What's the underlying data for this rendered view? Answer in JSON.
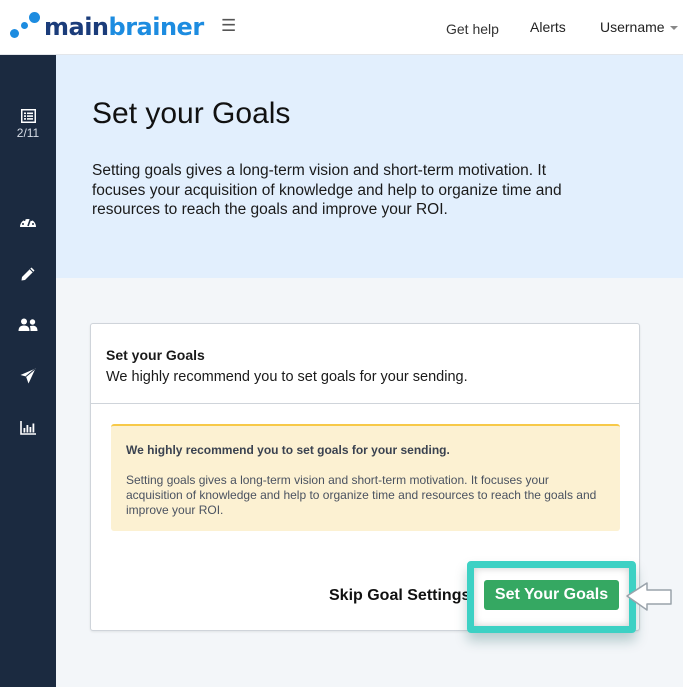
{
  "header": {
    "logo": {
      "part1": "main",
      "part2": "brainer"
    },
    "menu_icon": "hamburger-icon",
    "nav": {
      "help": "Get help",
      "alerts": "Alerts",
      "user": "Username"
    }
  },
  "sidebar": {
    "items": [
      {
        "icon": "list-icon",
        "label": "2/11"
      },
      {
        "icon": "dashboard-gauge-icon"
      },
      {
        "icon": "pencil-icon"
      },
      {
        "icon": "users-icon"
      },
      {
        "icon": "paper-plane-icon"
      },
      {
        "icon": "bar-chart-icon"
      }
    ]
  },
  "hero": {
    "title": "Set your Goals",
    "description": "Setting goals gives a long-term vision and short-term motivation. It focuses your acquisition of knowledge and help to organize time and resources to reach the goals and improve your ROI."
  },
  "card": {
    "title": "Set your Goals",
    "subtitle": "We highly recommend you to set goals for your sending.",
    "alert": {
      "title": "We highly recommend you to set goals for your sending.",
      "body": "Setting goals gives a long-term vision and short-term motivation. It focuses your acquisition of knowledge and help to organize time and resources to reach the goals and improve your ROI."
    },
    "skip_label": "Skip Goal Settings",
    "primary_label": "Set Your Goals"
  },
  "colors": {
    "brand_dark": "#1b3c7a",
    "brand_light": "#1d8ce0",
    "sidebar_bg": "#1b2a40",
    "hero_bg": "#e2effd",
    "primary_button": "#35a862",
    "highlight": "#3dd1c4",
    "alert_bg": "#fcf1d2",
    "alert_border": "#f7c948"
  }
}
